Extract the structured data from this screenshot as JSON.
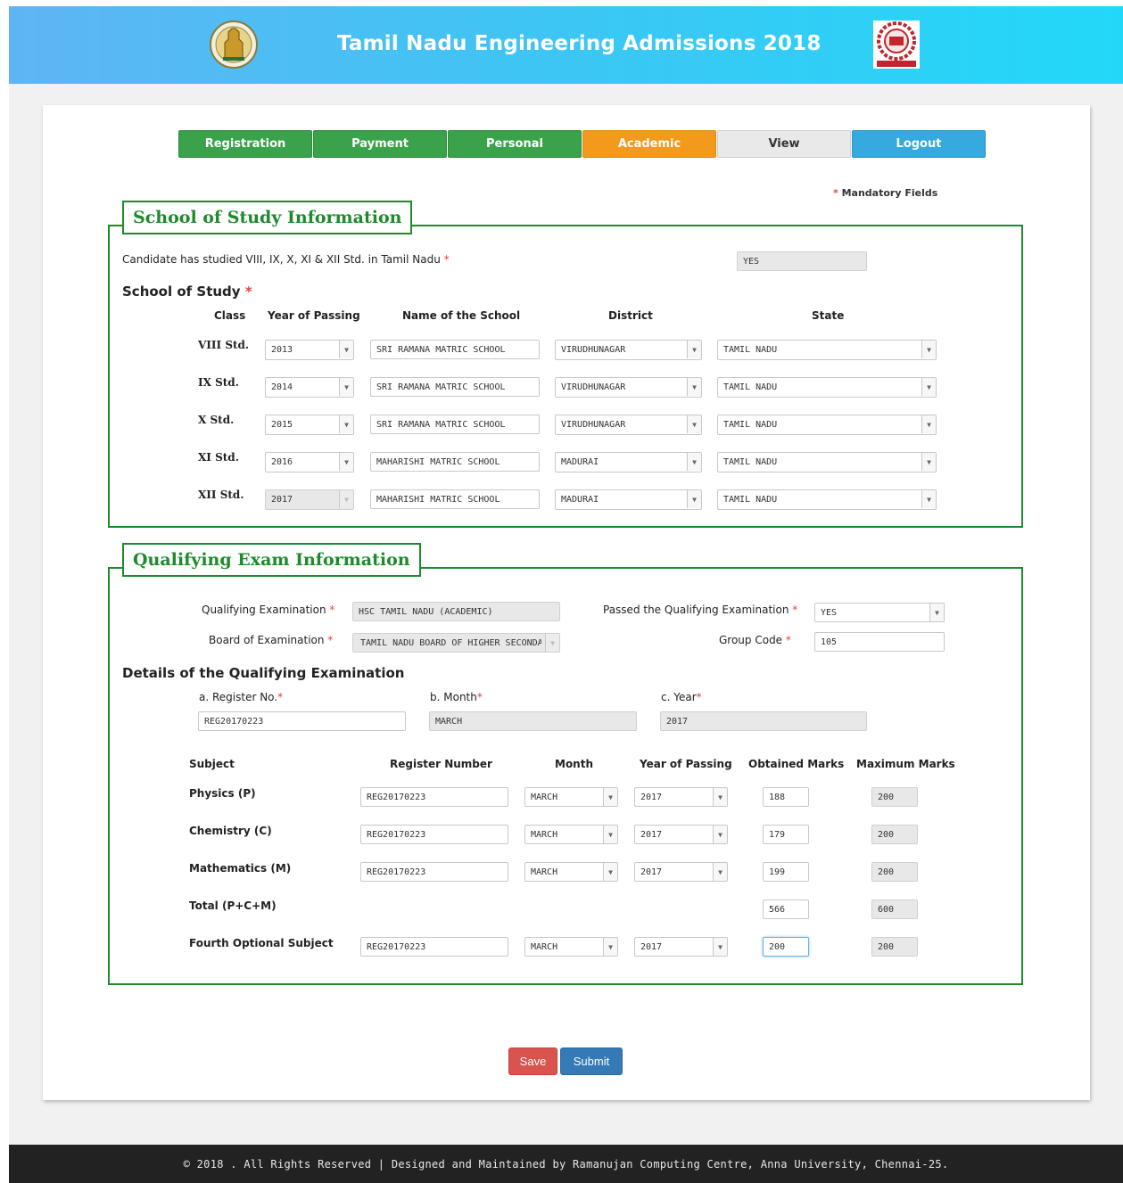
{
  "header": {
    "title": "Tamil Nadu Engineering Admissions 2018"
  },
  "nav": {
    "tabs": [
      {
        "label": "Registration",
        "state": "green"
      },
      {
        "label": "Payment",
        "state": "green"
      },
      {
        "label": "Personal",
        "state": "green"
      },
      {
        "label": "Academic",
        "state": "active"
      },
      {
        "label": "View",
        "state": "gray"
      },
      {
        "label": "Logout",
        "state": "blue"
      }
    ]
  },
  "mandatory_note": "Mandatory Fields",
  "asterisk": "*",
  "school": {
    "legend": "School of Study Information",
    "tn_question": "Candidate has studied VIII, IX, X, XI & XII Std. in Tamil Nadu",
    "tn_answer": "YES",
    "subheading": "School of Study",
    "headers": {
      "class": "Class",
      "year": "Year of Passing",
      "school": "Name of the School",
      "district": "District",
      "state": "State"
    },
    "rows": [
      {
        "class": "VIII Std.",
        "year": "2013",
        "school": "SRI RAMANA MATRIC SCHOOL",
        "district": "VIRUDHUNAGAR",
        "state": "TAMIL NADU"
      },
      {
        "class": "IX Std.",
        "year": "2014",
        "school": "SRI RAMANA MATRIC SCHOOL",
        "district": "VIRUDHUNAGAR",
        "state": "TAMIL NADU"
      },
      {
        "class": "X Std.",
        "year": "2015",
        "school": "SRI RAMANA MATRIC SCHOOL",
        "district": "VIRUDHUNAGAR",
        "state": "TAMIL NADU"
      },
      {
        "class": "XI Std.",
        "year": "2016",
        "school": "MAHARISHI MATRIC SCHOOL",
        "district": "MADURAI",
        "state": "TAMIL NADU"
      },
      {
        "class": "XII Std.",
        "year": "2017",
        "school": "MAHARISHI MATRIC SCHOOL",
        "district": "MADURAI",
        "state": "TAMIL NADU"
      }
    ]
  },
  "qualifying": {
    "legend": "Qualifying Exam Information",
    "exam_label": "Qualifying Examination",
    "exam_value": "HSC TAMIL NADU (ACADEMIC)",
    "board_label": "Board of Examination",
    "board_value": "TAMIL NADU BOARD OF HIGHER SECONDARY",
    "passed_label": "Passed the Qualifying Examination",
    "passed_value": "YES",
    "group_label": "Group Code",
    "group_value": "105",
    "details_heading": "Details of the Qualifying Examination",
    "reg_label": "a. Register No.",
    "reg_value": "REG20170223",
    "month_label": "b. Month",
    "month_value": "MARCH",
    "year_label": "c. Year",
    "year_value": "2017",
    "headers": {
      "subject": "Subject",
      "register": "Register Number",
      "month": "Month",
      "year": "Year of Passing",
      "obtained": "Obtained Marks",
      "maximum": "Maximum Marks"
    },
    "subjects": [
      {
        "name": "Physics (P)",
        "register": "REG20170223",
        "month": "MARCH",
        "year": "2017",
        "obtained": "188",
        "maximum": "200"
      },
      {
        "name": "Chemistry (C)",
        "register": "REG20170223",
        "month": "MARCH",
        "year": "2017",
        "obtained": "179",
        "maximum": "200"
      },
      {
        "name": "Mathematics (M)",
        "register": "REG20170223",
        "month": "MARCH",
        "year": "2017",
        "obtained": "199",
        "maximum": "200"
      }
    ],
    "total": {
      "name": "Total (P+C+M)",
      "obtained": "566",
      "maximum": "600"
    },
    "fourth": {
      "name": "Fourth Optional Subject",
      "register": "REG20170223",
      "month": "MARCH",
      "year": "2017",
      "obtained": "200",
      "maximum": "200"
    }
  },
  "actions": {
    "save": "Save",
    "submit": "Submit"
  },
  "footer": "© 2018 . All Rights Reserved | Designed and Maintained by Ramanujan Computing Centre, Anna University, Chennai-25.",
  "colors": {
    "header_start": "#5fb5f4",
    "header_end": "#22d8f8",
    "green": "#3aa24b",
    "active": "#f39a1c",
    "legend": "#1e8a2b",
    "save": "#d9534f",
    "submit": "#337ab7"
  }
}
